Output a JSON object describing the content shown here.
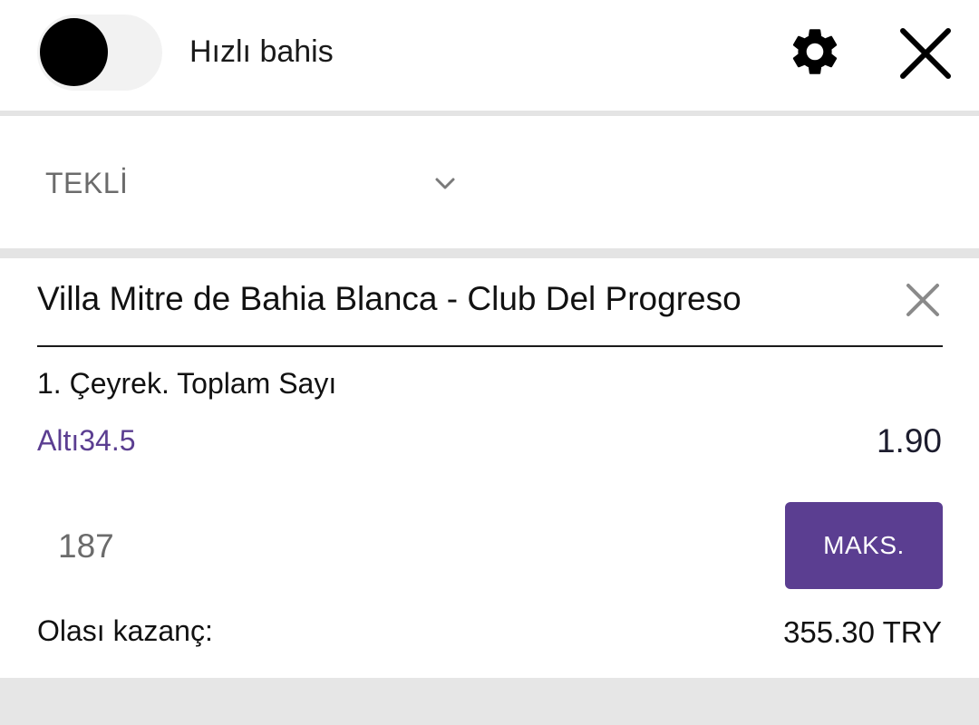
{
  "header": {
    "quick_bet_label": "Hızlı bahis",
    "quick_bet_enabled": false,
    "settings_icon": "gear-icon",
    "close_icon": "close-icon"
  },
  "bet_type": {
    "selected": "TEKLİ",
    "dropdown_icon": "chevron-down-icon"
  },
  "bet": {
    "match": "Villa Mitre de Bahia Blanca - Club Del Progreso",
    "market": "1. Çeyrek. Toplam Sayı",
    "selection": "Altı34.5",
    "odds": "1.90",
    "stake": "187",
    "max_label": "MAKS.",
    "potential_win_label": "Olası kazanç:",
    "potential_win_value": "355.30 TRY",
    "remove_icon": "close-icon"
  },
  "colors": {
    "accent": "#5b3e91",
    "toggle_knob": "#000000",
    "toggle_track": "#f2f2f2",
    "background": "#e6e6e6"
  }
}
